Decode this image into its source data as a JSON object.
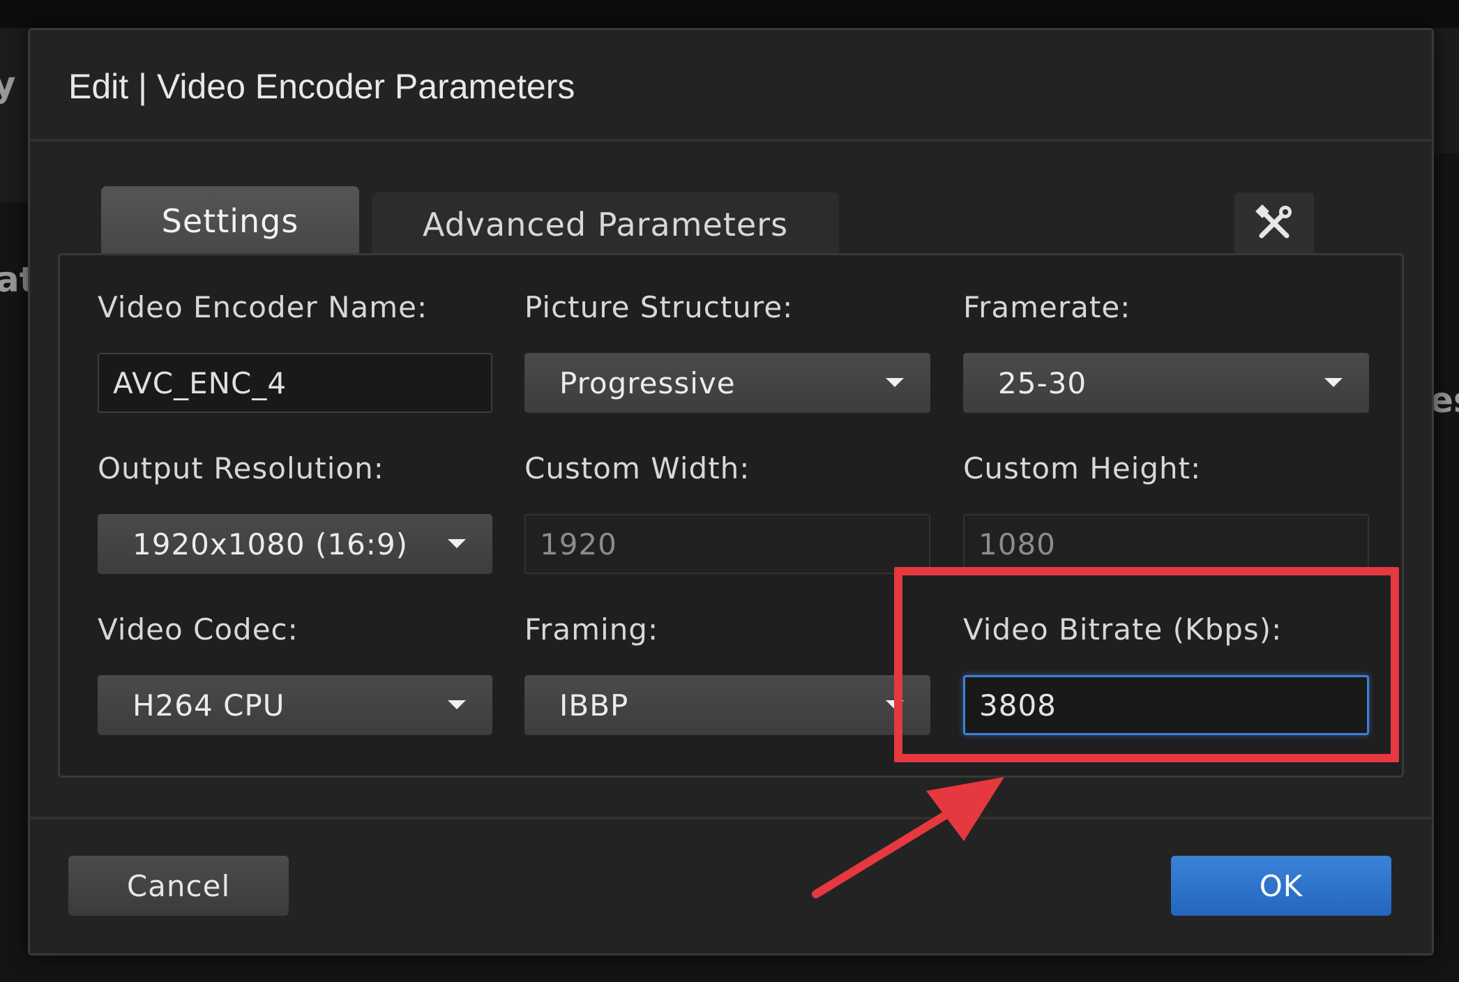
{
  "background": {
    "left_fragment_1": "y D",
    "left_fragment_2": "at",
    "right_fragment": "es"
  },
  "dialog": {
    "title": "Edit | Video Encoder Parameters",
    "tabs": [
      {
        "label": "Settings",
        "active": true
      },
      {
        "label": "Advanced Parameters",
        "active": false
      }
    ],
    "tools_icon": "wrench-screwdriver-icon"
  },
  "fields": {
    "encoder_name": {
      "label": "Video Encoder Name:",
      "value": "AVC_ENC_4"
    },
    "picture_structure": {
      "label": "Picture Structure:",
      "value": "Progressive"
    },
    "framerate": {
      "label": "Framerate:",
      "value": "25-30"
    },
    "output_resolution": {
      "label": "Output Resolution:",
      "value": "1920x1080 (16:9)"
    },
    "custom_width": {
      "label": "Custom Width:",
      "value": "1920"
    },
    "custom_height": {
      "label": "Custom Height:",
      "value": "1080"
    },
    "video_codec": {
      "label": "Video Codec:",
      "value": "H264 CPU"
    },
    "framing": {
      "label": "Framing:",
      "value": "IBBP"
    },
    "video_bitrate": {
      "label": "Video Bitrate (Kbps):",
      "value": "3808"
    }
  },
  "footer": {
    "cancel_label": "Cancel",
    "ok_label": "OK"
  },
  "colors": {
    "highlight": "#e5383f",
    "accent": "#2f74cc",
    "focus": "#3f7fd6"
  }
}
